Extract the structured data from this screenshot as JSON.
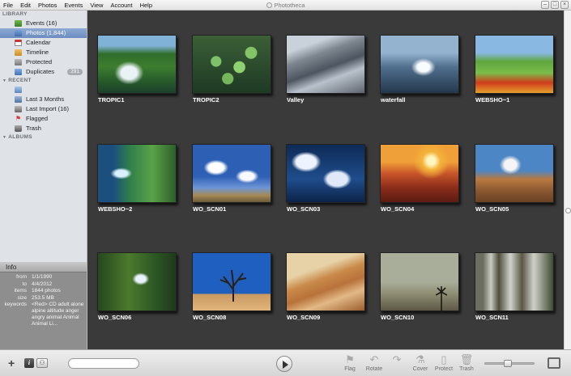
{
  "app": {
    "title": "Phototheca",
    "menu": [
      "File",
      "Edit",
      "Photos",
      "Events",
      "View",
      "Account",
      "Help"
    ]
  },
  "sidebar": {
    "library_header": "LIBRARY",
    "library": [
      {
        "label": "Events (16)",
        "icon": "events-icon"
      },
      {
        "label": "Photos (1,844)",
        "icon": "photos-icon",
        "selected": true
      },
      {
        "label": "Calendar",
        "icon": "calendar-icon"
      },
      {
        "label": "Timeline",
        "icon": "timeline-icon"
      },
      {
        "label": "Protected",
        "icon": "lock-icon"
      },
      {
        "label": "Duplicates",
        "icon": "duplicates-icon",
        "badge": "291"
      }
    ],
    "recent_header": "RECENT",
    "recent": [
      {
        "label": "",
        "icon": "recent-edit-icon"
      },
      {
        "label": "Last 3 Months",
        "icon": "months-icon"
      },
      {
        "label": "Last Import (16)",
        "icon": "import-icon"
      },
      {
        "label": "Flagged",
        "icon": "flag-icon"
      },
      {
        "label": "Trash",
        "icon": "trash-icon"
      }
    ],
    "albums_header": "ALBUMS"
  },
  "info": {
    "title": "Info",
    "rows": [
      {
        "key": "from",
        "value": "1/1/1990"
      },
      {
        "key": "to",
        "value": "4/4/2012"
      },
      {
        "key": "items",
        "value": "1844 photos"
      },
      {
        "key": "size",
        "value": "253.5 MB"
      },
      {
        "key": "keywords",
        "value": "<Red> CD adult alone alpine altitude anger angry animal Animal Animal Li..."
      }
    ]
  },
  "photos": [
    {
      "caption": "TROPIC1",
      "style": "tropic1"
    },
    {
      "caption": "TROPIC2",
      "style": "tropic2"
    },
    {
      "caption": "Valley",
      "style": "valley"
    },
    {
      "caption": "waterfall",
      "style": "waterfall"
    },
    {
      "caption": "WEBSHO~1",
      "style": "websho1"
    },
    {
      "caption": "WEBSHO~2",
      "style": "websho2"
    },
    {
      "caption": "WO_SCN01",
      "style": "scn01"
    },
    {
      "caption": "WO_SCN03",
      "style": "scn03"
    },
    {
      "caption": "WO_SCN04",
      "style": "scn04"
    },
    {
      "caption": "WO_SCN05",
      "style": "scn05"
    },
    {
      "caption": "WO_SCN06",
      "style": "scn06"
    },
    {
      "caption": "WO_SCN08",
      "style": "scn08"
    },
    {
      "caption": "WO_SCN09",
      "style": "scn09"
    },
    {
      "caption": "WO_SCN10",
      "style": "scn10"
    },
    {
      "caption": "WO_SCN11",
      "style": "scn11"
    }
  ],
  "toolbar": {
    "search_placeholder": "",
    "actions": [
      {
        "label": "Flag",
        "icon": "flag-icon"
      },
      {
        "label": "Rotate",
        "icon": "rotate-left-icon"
      },
      {
        "label": "",
        "icon": "rotate-right-icon"
      },
      {
        "label": "Cover",
        "icon": "cover-icon"
      },
      {
        "label": "Protect",
        "icon": "protect-icon"
      },
      {
        "label": "Trash",
        "icon": "trash-icon"
      }
    ],
    "zoom_level": 0.45
  },
  "colors": {
    "accent": "#7896c8",
    "content_bg": "#3a3a3a",
    "sidebar_bg": "#dfe3e8"
  }
}
